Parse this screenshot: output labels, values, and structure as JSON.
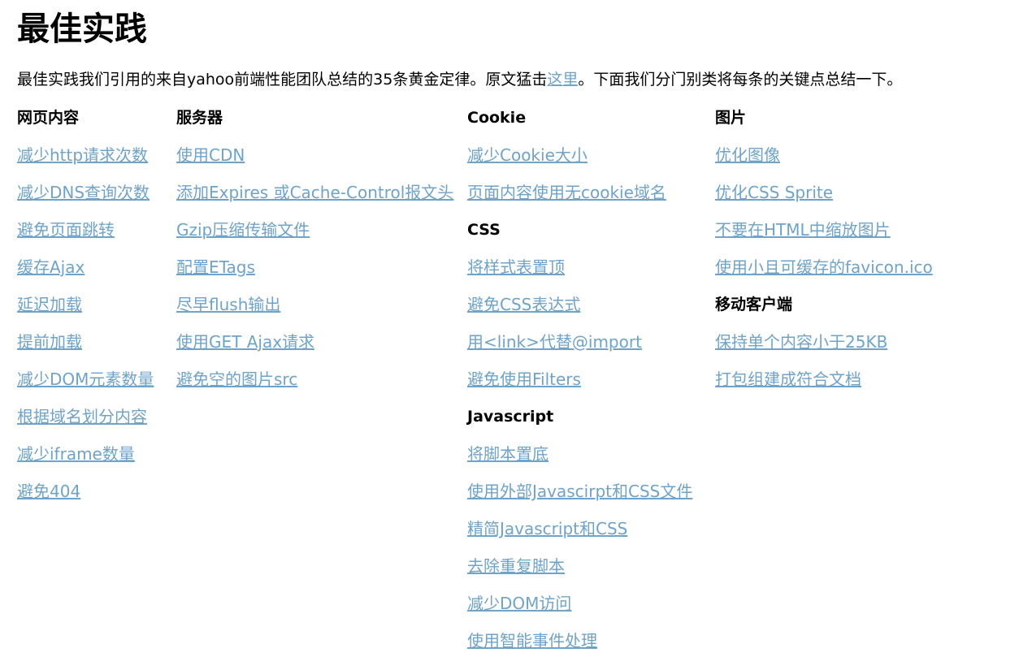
{
  "page": {
    "title": "最佳实践",
    "intro_before": "最佳实践我们引用的来自yahoo前端性能团队总结的35条黄金定律。原文猛击",
    "intro_link": "这里",
    "intro_after": "。下面我们分门别类将每条的关键点总结一下。",
    "link_color": "#6fa3c9"
  },
  "columns": [
    {
      "sections": [
        {
          "heading": "网页内容",
          "items": [
            "减少http请求次数",
            "减少DNS查询次数",
            "避免页面跳转",
            "缓存Ajax",
            "延迟加载",
            "提前加载",
            "减少DOM元素数量",
            "根据域名划分内容",
            "减少iframe数量",
            "避免404"
          ]
        }
      ]
    },
    {
      "sections": [
        {
          "heading": "服务器",
          "items": [
            "使用CDN",
            "添加Expires 或Cache-Control报文头",
            "Gzip压缩传输文件",
            "配置ETags",
            "尽早flush输出",
            "使用GET Ajax请求",
            "避免空的图片src"
          ]
        }
      ]
    },
    {
      "sections": [
        {
          "heading": "Cookie",
          "items": [
            "减少Cookie大小",
            "页面内容使用无cookie域名"
          ]
        },
        {
          "heading": "CSS",
          "items": [
            "将样式表置顶",
            "避免CSS表达式",
            "用<link>代替@import",
            "避免使用Filters"
          ]
        },
        {
          "heading": "Javascript",
          "items": [
            "将脚本置底",
            "使用外部Javascirpt和CSS文件",
            "精简Javascript和CSS",
            "去除重复脚本",
            "减少DOM访问",
            "使用智能事件处理"
          ]
        }
      ]
    },
    {
      "sections": [
        {
          "heading": "图片",
          "items": [
            "优化图像",
            "优化CSS Sprite",
            "不要在HTML中缩放图片",
            "使用小且可缓存的favicon.ico"
          ]
        },
        {
          "heading": "移动客户端",
          "items": [
            "保持单个内容小于25KB",
            "打包组建成符合文档"
          ]
        }
      ]
    }
  ]
}
